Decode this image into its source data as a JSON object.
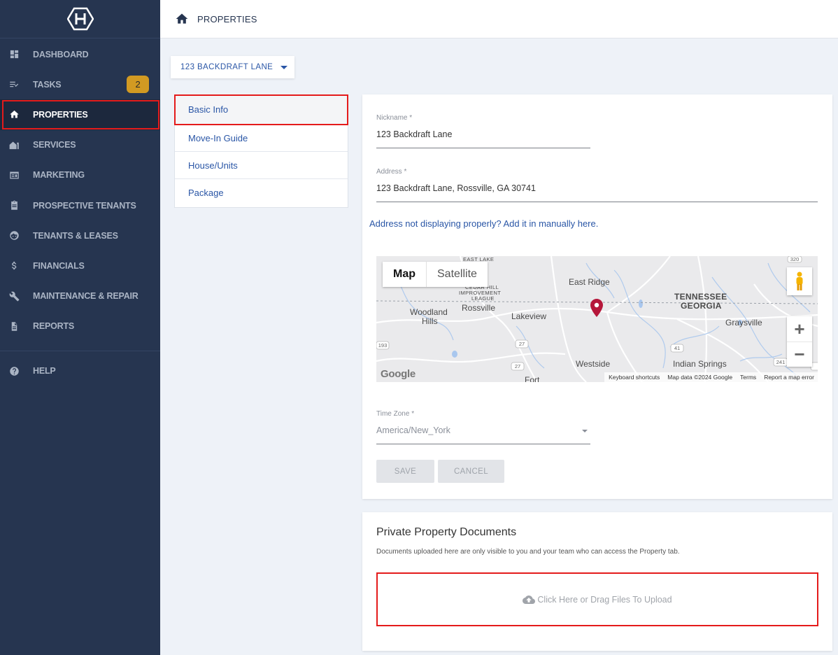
{
  "sidebar": {
    "logo_icon": "hexagon-h-logo",
    "items": [
      {
        "label": "DASHBOARD",
        "icon": "dashboard-icon",
        "active": false
      },
      {
        "label": "TASKS",
        "icon": "tasks-icon",
        "active": false,
        "badge": "2"
      },
      {
        "label": "PROPERTIES",
        "icon": "home-icon",
        "active": true
      },
      {
        "label": "SERVICES",
        "icon": "services-icon",
        "active": false
      },
      {
        "label": "MARKETING",
        "icon": "marketing-icon",
        "active": false
      },
      {
        "label": "PROSPECTIVE TENANTS",
        "icon": "clipboard-icon",
        "active": false
      },
      {
        "label": "TENANTS & LEASES",
        "icon": "face-icon",
        "active": false
      },
      {
        "label": "FINANCIALS",
        "icon": "dollar-icon",
        "active": false
      },
      {
        "label": "MAINTENANCE & REPAIR",
        "icon": "wrench-icon",
        "active": false
      },
      {
        "label": "REPORTS",
        "icon": "document-icon",
        "active": false
      }
    ],
    "help": {
      "label": "HELP",
      "icon": "help-icon"
    }
  },
  "topbar": {
    "breadcrumb": "PROPERTIES",
    "icon": "home-icon"
  },
  "property_selector": {
    "value": "123 BACKDRAFT LANE"
  },
  "subnav": {
    "items": [
      {
        "label": "Basic Info",
        "active": true
      },
      {
        "label": "Move-In Guide",
        "active": false
      },
      {
        "label": "House/Units",
        "active": false
      },
      {
        "label": "Package",
        "active": false
      }
    ]
  },
  "basic_info": {
    "nickname_label": "Nickname *",
    "nickname_value": "123 Backdraft Lane",
    "address_label": "Address *",
    "address_value": "123 Backdraft Lane, Rossville, GA 30741",
    "manual_link": "Address not displaying properly? Add it in manually here.",
    "timezone_label": "Time Zone *",
    "timezone_value": "America/New_York",
    "save_label": "SAVE",
    "cancel_label": "CANCEL"
  },
  "map": {
    "tabs": [
      "Map",
      "Satellite"
    ],
    "labels": {
      "east_lake": "EAST LAKE",
      "cedar_hill": "CEDAR HILL",
      "improvement": "IMPROVEMENT",
      "league": "LEAGUE",
      "east_ridge": "East Ridge",
      "tennessee": "TENNESSEE",
      "georgia": "GEORGIA",
      "woodland": "Woodland",
      "hills": "Hills",
      "rossville": "Rossville",
      "lakeview": "Lakeview",
      "graysville": "Graysville",
      "westside": "Westside",
      "indian_springs": "Indian Springs",
      "fort": "Fort"
    },
    "road_shields": [
      "320",
      "193",
      "27",
      "27",
      "41",
      "241"
    ],
    "google": "Google",
    "footer": [
      "Keyboard shortcuts",
      "Map data ©2024 Google",
      "Terms",
      "Report a map error"
    ],
    "zoom_in": "+",
    "zoom_out": "−"
  },
  "documents": {
    "title": "Private Property Documents",
    "description": "Documents uploaded here are only visible to you and your team who can access the Property tab.",
    "upload_label": "Click Here or Drag Files To Upload",
    "upload_icon": "cloud-upload-icon"
  },
  "colors": {
    "sidebar_bg": "#263550",
    "accent_blue": "#2a56a6",
    "badge": "#d29a22",
    "highlight_red": "#e41b1b"
  }
}
